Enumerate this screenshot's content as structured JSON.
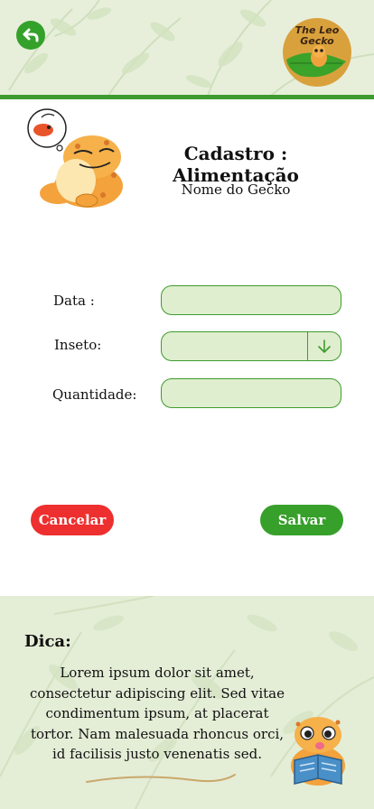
{
  "header": {
    "back_icon": "back-arrow-icon",
    "logo_text_line1": "The Leo",
    "logo_text_line2": "Gecko"
  },
  "page": {
    "title": "Cadastro : Alimentação",
    "subtitle": "Nome do Gecko"
  },
  "form": {
    "date_label": "Data :",
    "date_value": "",
    "insect_label": "Inseto:",
    "insect_value": "",
    "quantity_label": "Quantidade:",
    "quantity_value": ""
  },
  "actions": {
    "cancel_label": "Cancelar",
    "save_label": "Salvar"
  },
  "tip": {
    "title": "Dica:",
    "text": "Lorem ipsum dolor sit amet, consectetur adipiscing elit. Sed vitae condimentum ipsum, at placerat tortor. Nam malesuada rhoncus orci, id facilisis justo venenatis sed."
  },
  "colors": {
    "primary_green": "#37a02a",
    "cancel_red": "#ee2f2f",
    "field_bg": "#dfeece",
    "pale_bg": "#e7efdb"
  }
}
